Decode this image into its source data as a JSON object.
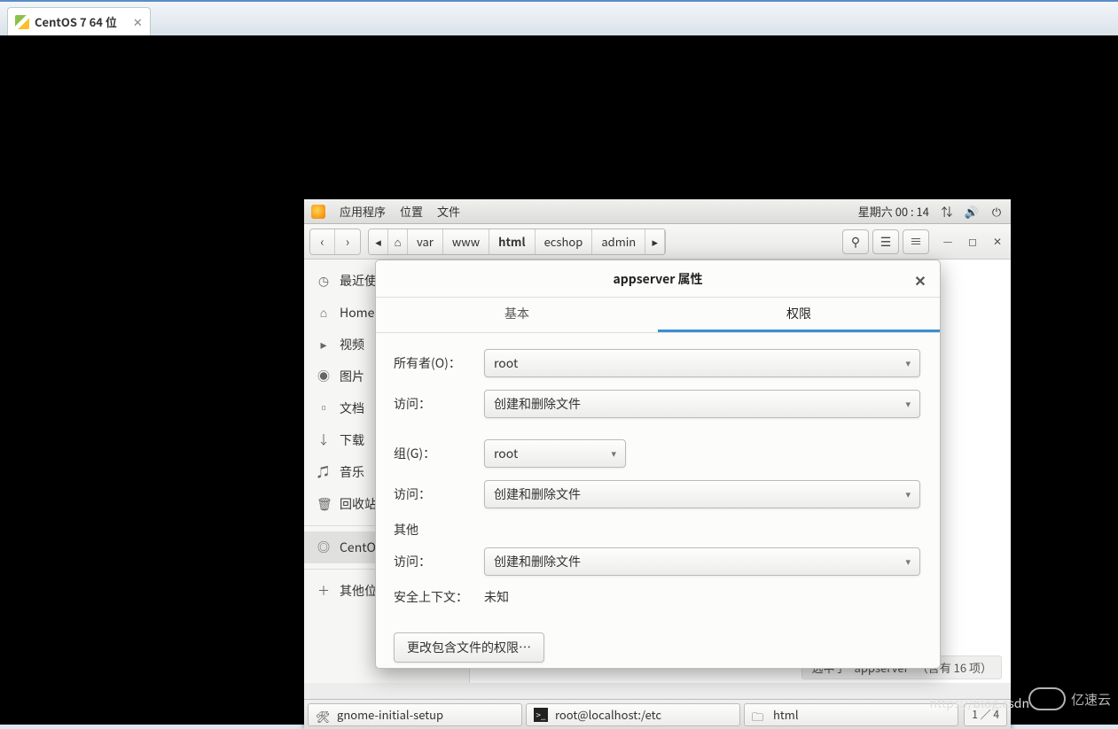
{
  "host_tab": {
    "title": "CentOS 7 64 位"
  },
  "top_panel": {
    "apps": "应用程序",
    "places": "位置",
    "files": "文件",
    "datetime": "星期六 00 : 14"
  },
  "fm": {
    "path": {
      "scroll_left": "◂",
      "home_icon": "⌂",
      "segments": [
        "var",
        "www",
        "html",
        "ecshop",
        "admin"
      ],
      "selected_index": 2,
      "scroll_right": "▸"
    },
    "nav": {
      "back": "‹",
      "forward": "›"
    },
    "sidebar": [
      {
        "icon": "◷",
        "label": "最近使"
      },
      {
        "icon": "⌂",
        "label": "Home"
      },
      {
        "icon": "▸",
        "label": "视频"
      },
      {
        "icon": "◉",
        "label": "图片"
      },
      {
        "icon": "▫",
        "label": "文档"
      },
      {
        "icon": "↓",
        "label": "下载"
      },
      {
        "icon": "♫",
        "label": "音乐"
      },
      {
        "icon": "🗑",
        "label": "回收站"
      },
      {
        "icon": "◎",
        "label": "CentO"
      },
      {
        "icon": "＋",
        "label": "其他位"
      }
    ],
    "status": "选中了 \"appserver\" （含有 16 项）"
  },
  "dialog": {
    "title": "appserver 属性",
    "tabs": {
      "basic": "基本",
      "perm": "权限"
    },
    "owner": {
      "label": "所有者(O)：",
      "value": "root"
    },
    "owner_access": {
      "label": "访问：",
      "value": "创建和删除文件"
    },
    "group": {
      "label": "组(G)：",
      "value": "root"
    },
    "group_access": {
      "label": "访问：",
      "value": "创建和删除文件"
    },
    "others_section": "其他",
    "others_access": {
      "label": "访问：",
      "value": "创建和删除文件"
    },
    "secontext": {
      "label": "安全上下文：",
      "value": "未知"
    },
    "recurse_btn": "更改包含文件的权限…"
  },
  "bottom": {
    "tasks": [
      {
        "icon": "tools",
        "label": "gnome-initial-setup"
      },
      {
        "icon": "term",
        "label": "root@localhost:/etc"
      },
      {
        "icon": "folder",
        "label": "html"
      }
    ],
    "pager": "1 ／ 4"
  },
  "blog_url": "https://blog.csdn",
  "watermark_text": "亿速云"
}
